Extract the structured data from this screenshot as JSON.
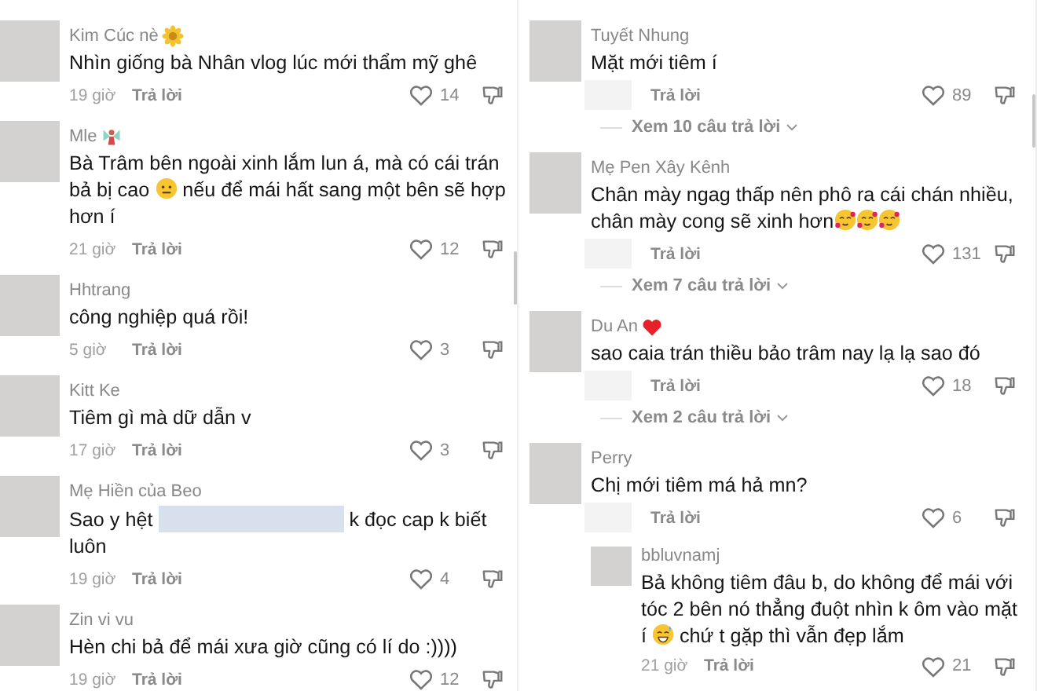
{
  "panels": [
    {
      "comments": [
        {
          "name": "Kim Cúc nè",
          "badge": {
            "kind": "flower"
          },
          "body": [
            {
              "kind": "text",
              "text": "Nhìn giống bà Nhân vlog lúc mới thẩm mỹ ghê"
            }
          ],
          "time_hidden": false,
          "time": "19 giờ",
          "reply": "Trả lời",
          "likes": "14"
        },
        {
          "name": "Mle",
          "badge": {
            "kind": "fairy"
          },
          "body": [
            {
              "kind": "text",
              "text": "Bà Trâm bên ngoài xinh lắm lun á, mà có cái trán bả bị cao "
            },
            {
              "kind": "neutral-face"
            },
            {
              "kind": "text",
              "text": " nếu để mái hất sang một bên sẽ hợp hơn í"
            }
          ],
          "time_hidden": false,
          "time": "21 giờ",
          "reply": "Trả lời",
          "likes": "12"
        },
        {
          "name": "Hhtrang",
          "body": [
            {
              "kind": "text",
              "text": "công nghiệp quá rồi!"
            }
          ],
          "time_hidden": false,
          "time": "5 giờ",
          "reply": "Trả lời",
          "likes": "3"
        },
        {
          "name": "Kitt Ke",
          "body": [
            {
              "kind": "text",
              "text": "Tiêm gì mà dữ dẫn v"
            }
          ],
          "time_hidden": false,
          "time": "17 giờ",
          "reply": "Trả lời",
          "likes": "3"
        },
        {
          "name": "Mẹ Hiền của Beo",
          "body": [
            {
              "kind": "text",
              "text": "Sao y hệt "
            },
            {
              "kind": "redacted"
            },
            {
              "kind": "text",
              "text": " k đọc cap k biết luôn"
            }
          ],
          "time_hidden": false,
          "time": "19 giờ",
          "reply": "Trả lời",
          "likes": "4"
        },
        {
          "name": "Zin vi vu",
          "body": [
            {
              "kind": "text",
              "text": "Hèn chi bả để mái xưa giờ cũng có lí do :))))"
            }
          ],
          "time_hidden": false,
          "time": "19 giờ",
          "reply": "Trả lời",
          "likes": "12"
        }
      ]
    },
    {
      "comments": [
        {
          "name": "Tuyết Nhung",
          "body": [
            {
              "kind": "text",
              "text": "Mặt mới tiêm í"
            }
          ],
          "time_hidden": true,
          "reply": "Trả lời",
          "likes": "89",
          "more_replies": "Xem 10 câu trả lời"
        },
        {
          "name": "Mẹ Pen Xây Kênh",
          "body": [
            {
              "kind": "text",
              "text": "Chân mày ngag thấp nên phô ra cái chán nhiều, chân mày cong sẽ xinh hơn"
            },
            {
              "kind": "hearts-face"
            },
            {
              "kind": "hearts-face"
            },
            {
              "kind": "hearts-face"
            }
          ],
          "time_hidden": true,
          "reply": "Trả lời",
          "likes": "131",
          "more_replies": "Xem 7 câu trả lời"
        },
        {
          "name": "Du An",
          "badge": {
            "kind": "heart"
          },
          "body": [
            {
              "kind": "text",
              "text": "sao caia trán thiều bảo trâm nay lạ lạ sao đó"
            }
          ],
          "time_hidden": true,
          "reply": "Trả lời",
          "likes": "18",
          "more_replies": "Xem 2 câu trả lời"
        },
        {
          "name": "Perry",
          "body": [
            {
              "kind": "text",
              "text": "Chị mới tiêm má hả mn?"
            }
          ],
          "time_hidden": true,
          "reply": "Trả lời",
          "likes": "6",
          "replies": [
            {
              "name": "bbluvnamj",
              "body": [
                {
                  "kind": "text",
                  "text": "Bả không tiêm đâu b, do không để mái với tóc 2 bên nó thẳng đuột nhìn k ôm vào mặt í "
                },
                {
                  "kind": "sweat-face"
                },
                {
                  "kind": "text",
                  "text": " chứ t gặp thì vẫn đẹp lắm"
                }
              ],
              "time_hidden": false,
              "time": "21 giờ",
              "reply": "Trả lời",
              "likes": "21"
            }
          ]
        }
      ]
    }
  ]
}
